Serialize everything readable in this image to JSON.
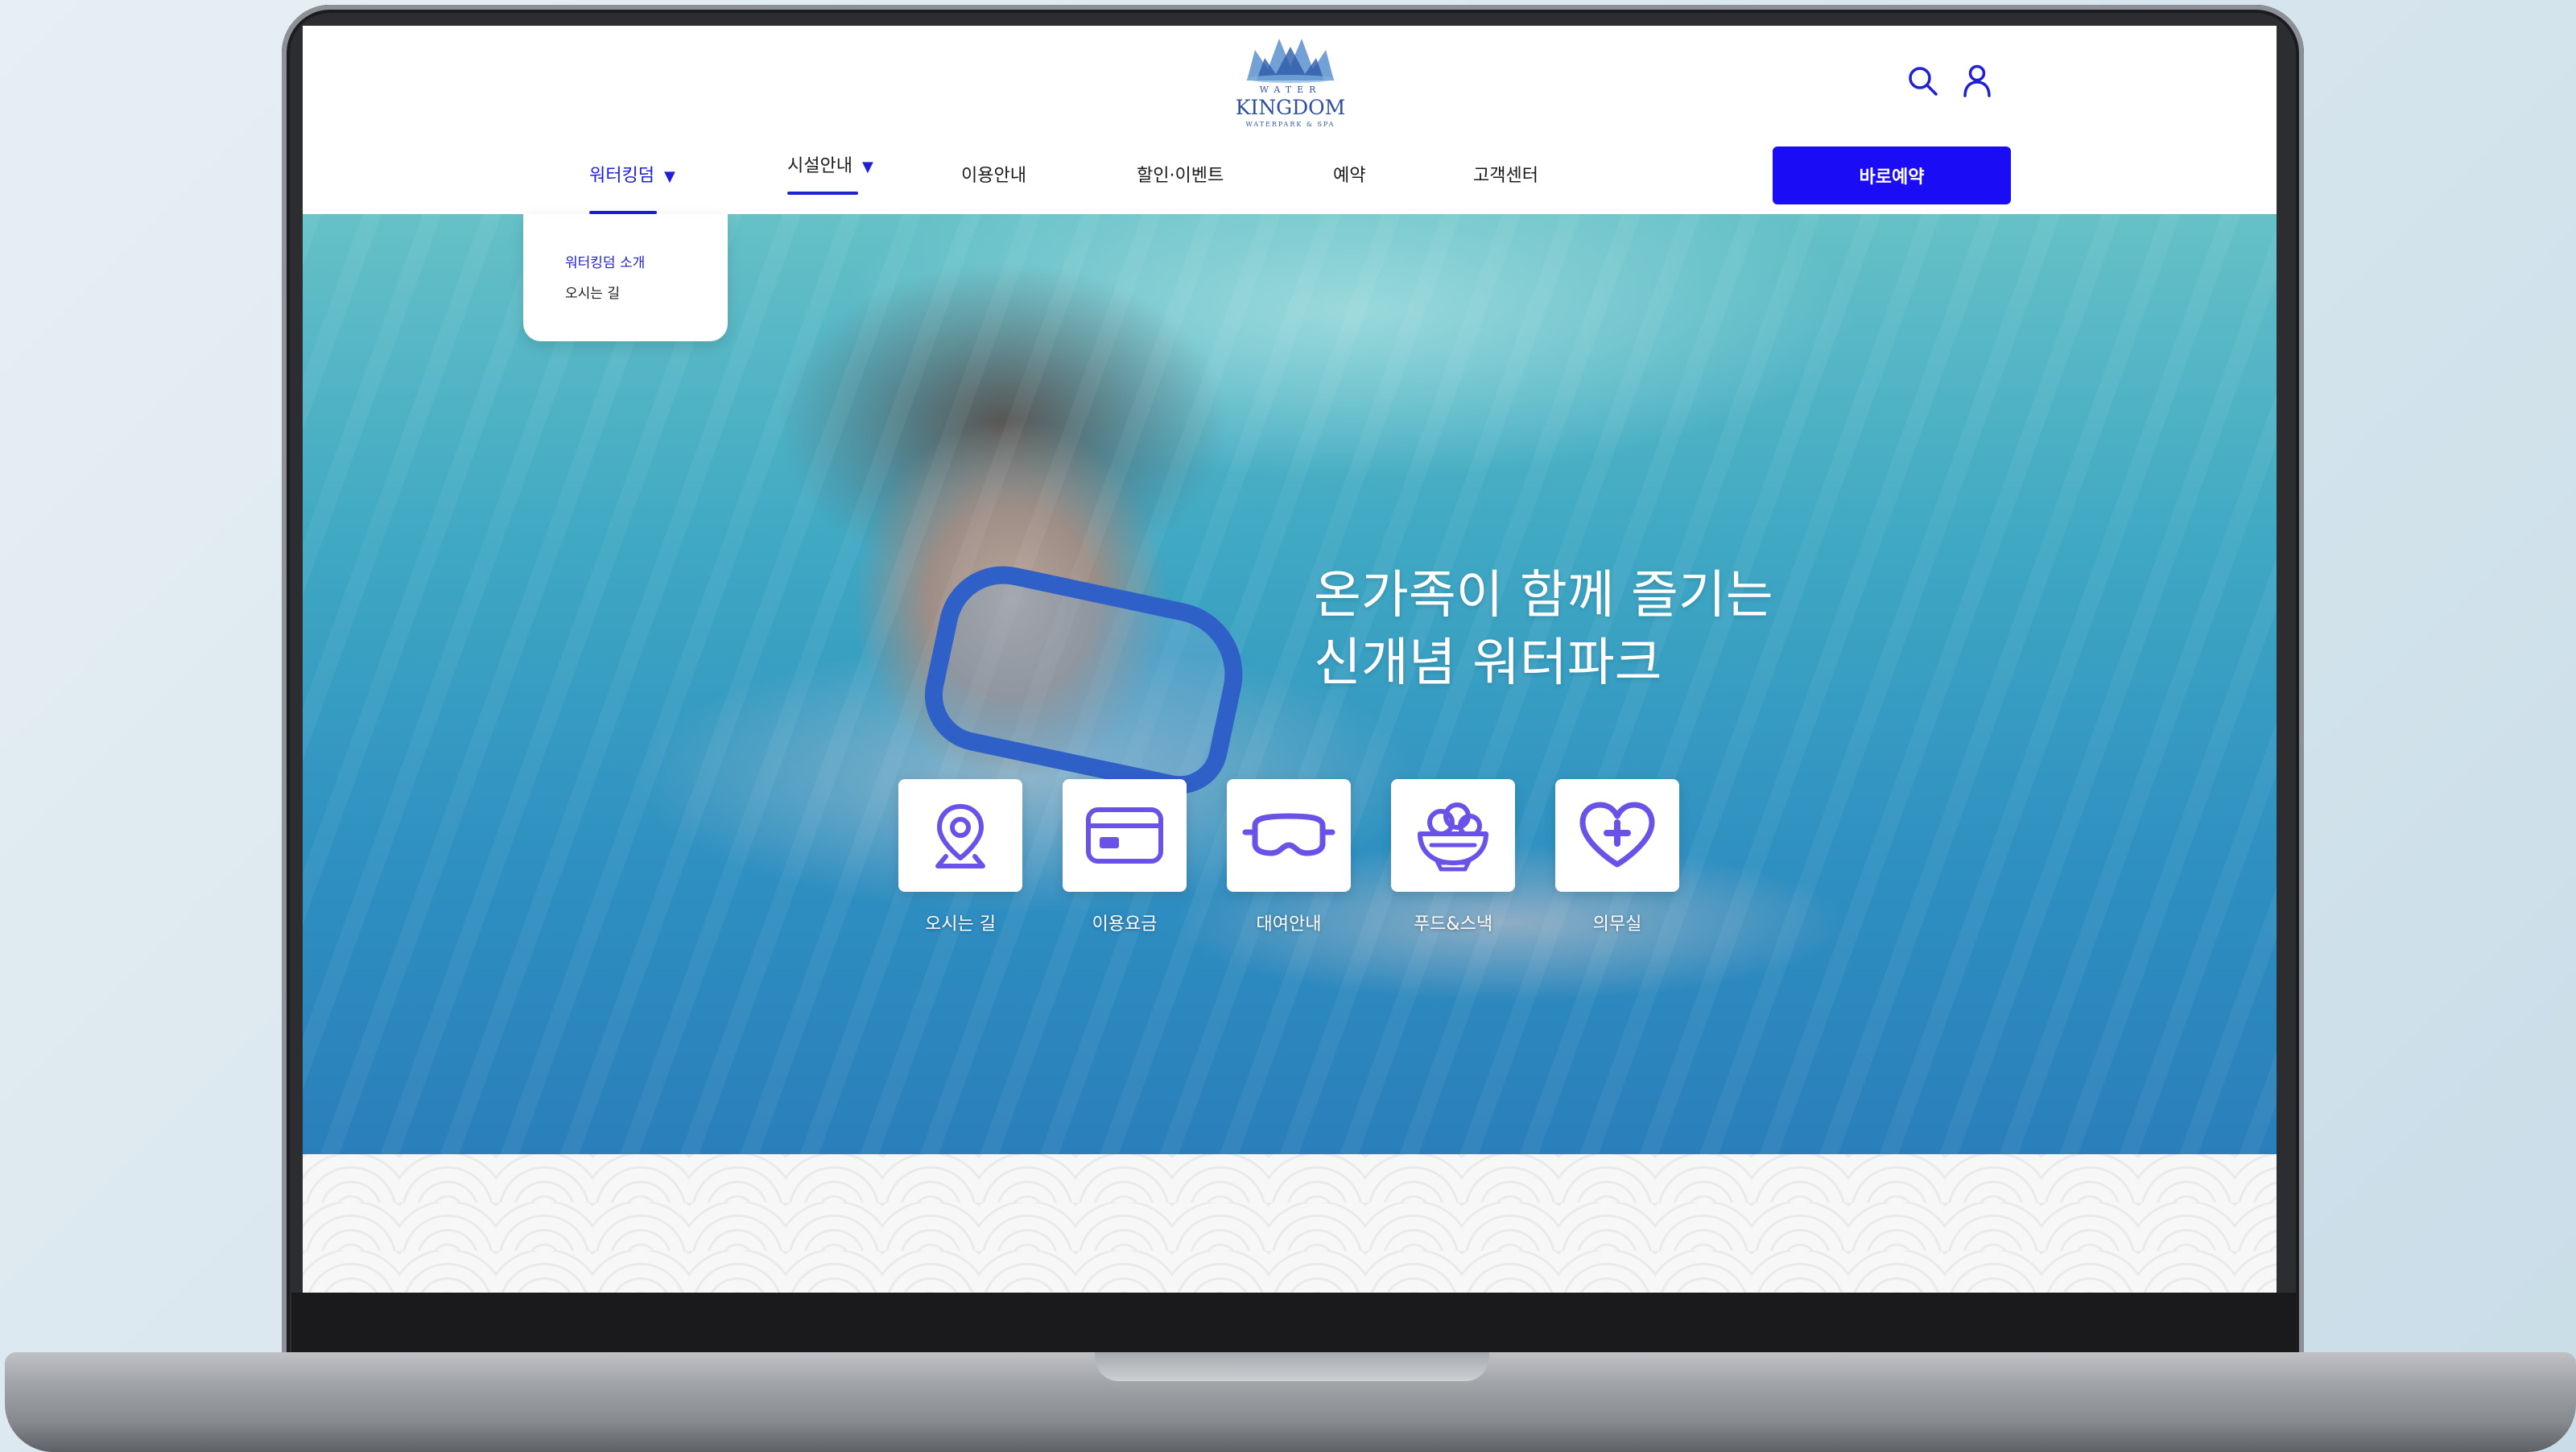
{
  "brand": {
    "logo_line1": "WATER",
    "logo_line2": "KINGDOM",
    "logo_line3": "WATERPARK & SPA",
    "accent_color": "#1a0cf4"
  },
  "header": {
    "search_icon": "search-icon",
    "user_icon": "user-icon",
    "nav": [
      {
        "label": "워터킹덤",
        "has_caret": true,
        "active": true
      },
      {
        "label": "시설안내",
        "has_caret": true,
        "active": false,
        "underlined": true
      },
      {
        "label": "이용안내"
      },
      {
        "label": "할인·이벤트"
      },
      {
        "label": "예약"
      },
      {
        "label": "고객센터"
      }
    ],
    "caret_glyph": "▼",
    "cta_label": "바로예약"
  },
  "dropdown": {
    "items": [
      {
        "label": "워터킹덤 소개",
        "active": true
      },
      {
        "label": "오시는 길",
        "active": false
      }
    ]
  },
  "hero": {
    "title_line1": "온가족이 함께 즐기는",
    "title_line2": "신개념 워터파크",
    "quick_links": [
      {
        "label": "오시는 길",
        "icon": "location-pin-icon"
      },
      {
        "label": "이용요금",
        "icon": "credit-card-icon"
      },
      {
        "label": "대여안내",
        "icon": "goggles-icon"
      },
      {
        "label": "푸드&스낵",
        "icon": "food-bowl-icon"
      },
      {
        "label": "의무실",
        "icon": "heart-plus-icon"
      }
    ],
    "icon_color": "#6a52e8"
  }
}
